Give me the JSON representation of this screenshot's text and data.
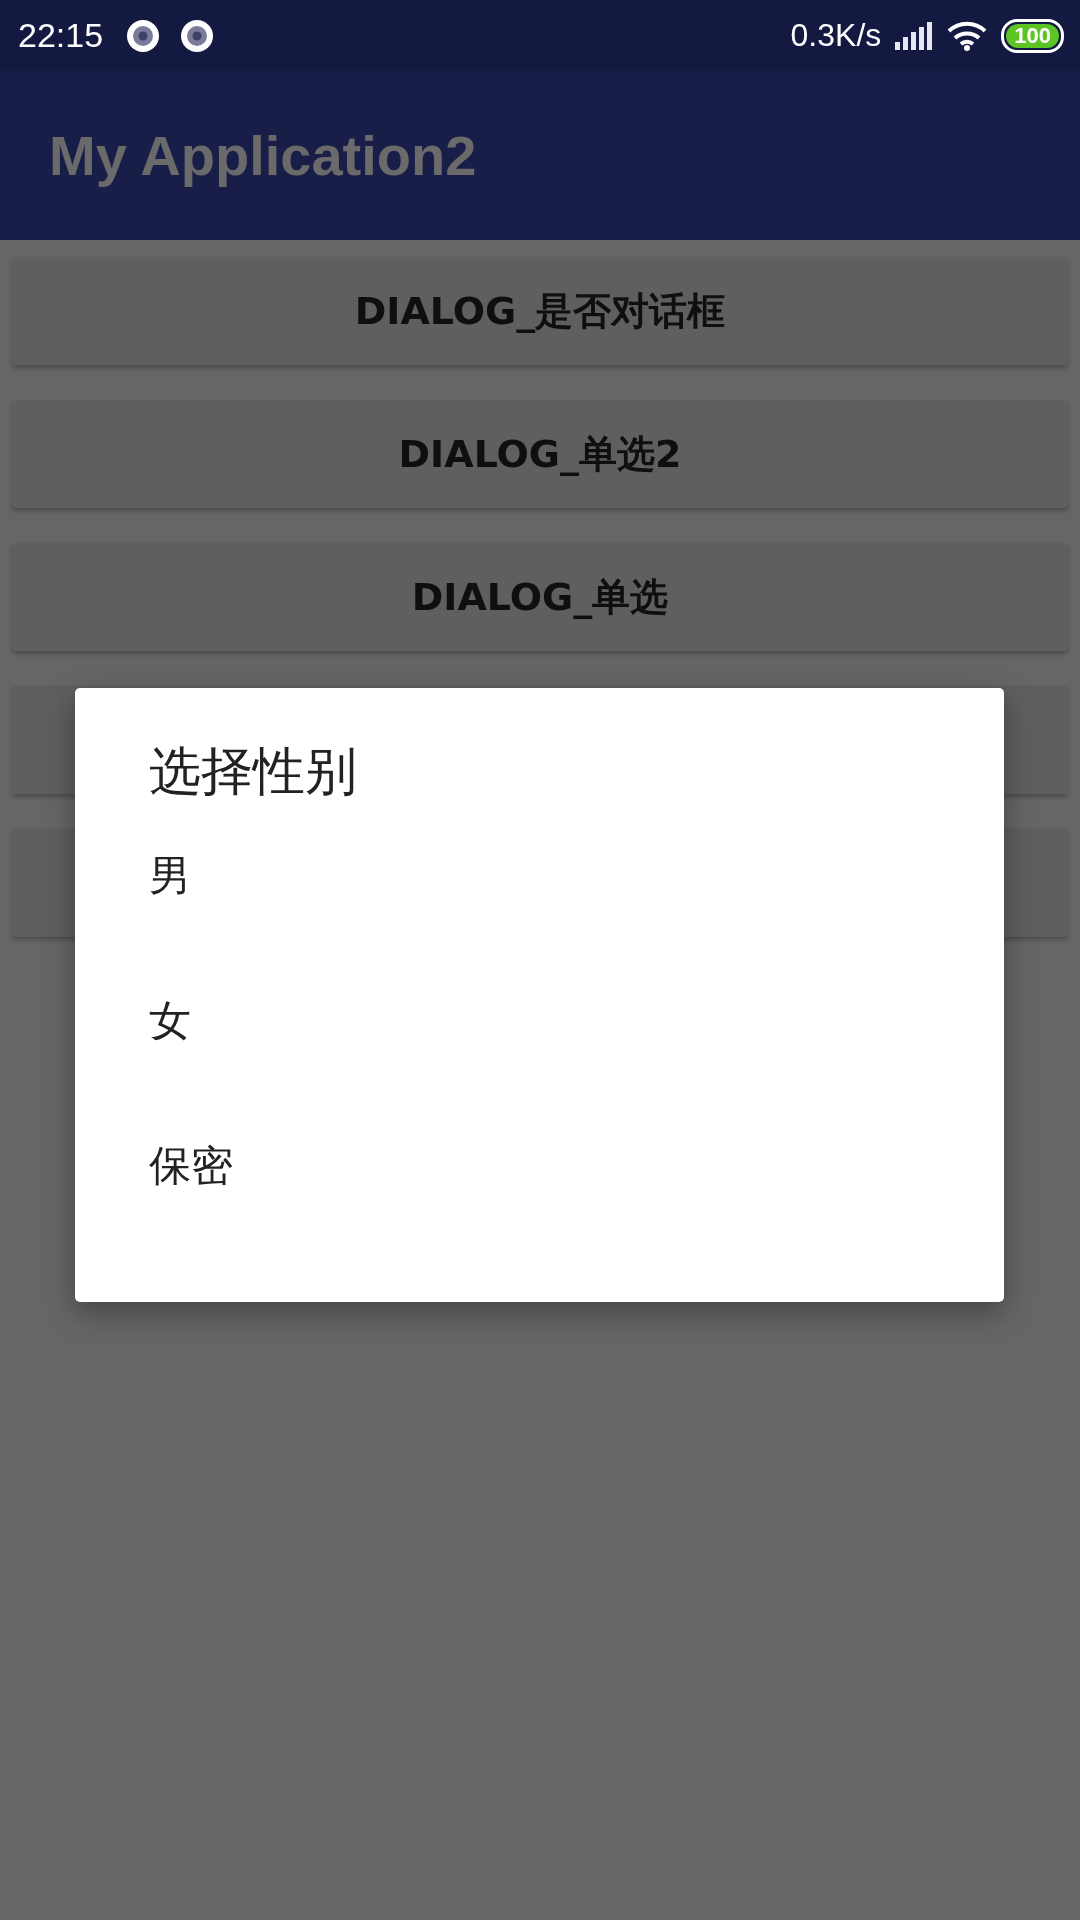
{
  "status_bar": {
    "time": "22:15",
    "speed": "0.3K/s",
    "battery": "100"
  },
  "app_bar": {
    "title": "My Application2"
  },
  "buttons": [
    {
      "kind": "labeled",
      "label": "DIALOG_是否对话框"
    },
    {
      "kind": "labeled",
      "label": "DIALOG_单选2"
    },
    {
      "kind": "labeled",
      "label": "DIALOG_单选"
    },
    {
      "kind": "covered"
    },
    {
      "kind": "covered"
    }
  ],
  "dialog": {
    "title": "选择性别",
    "items": [
      "男",
      "女",
      "保密"
    ]
  }
}
